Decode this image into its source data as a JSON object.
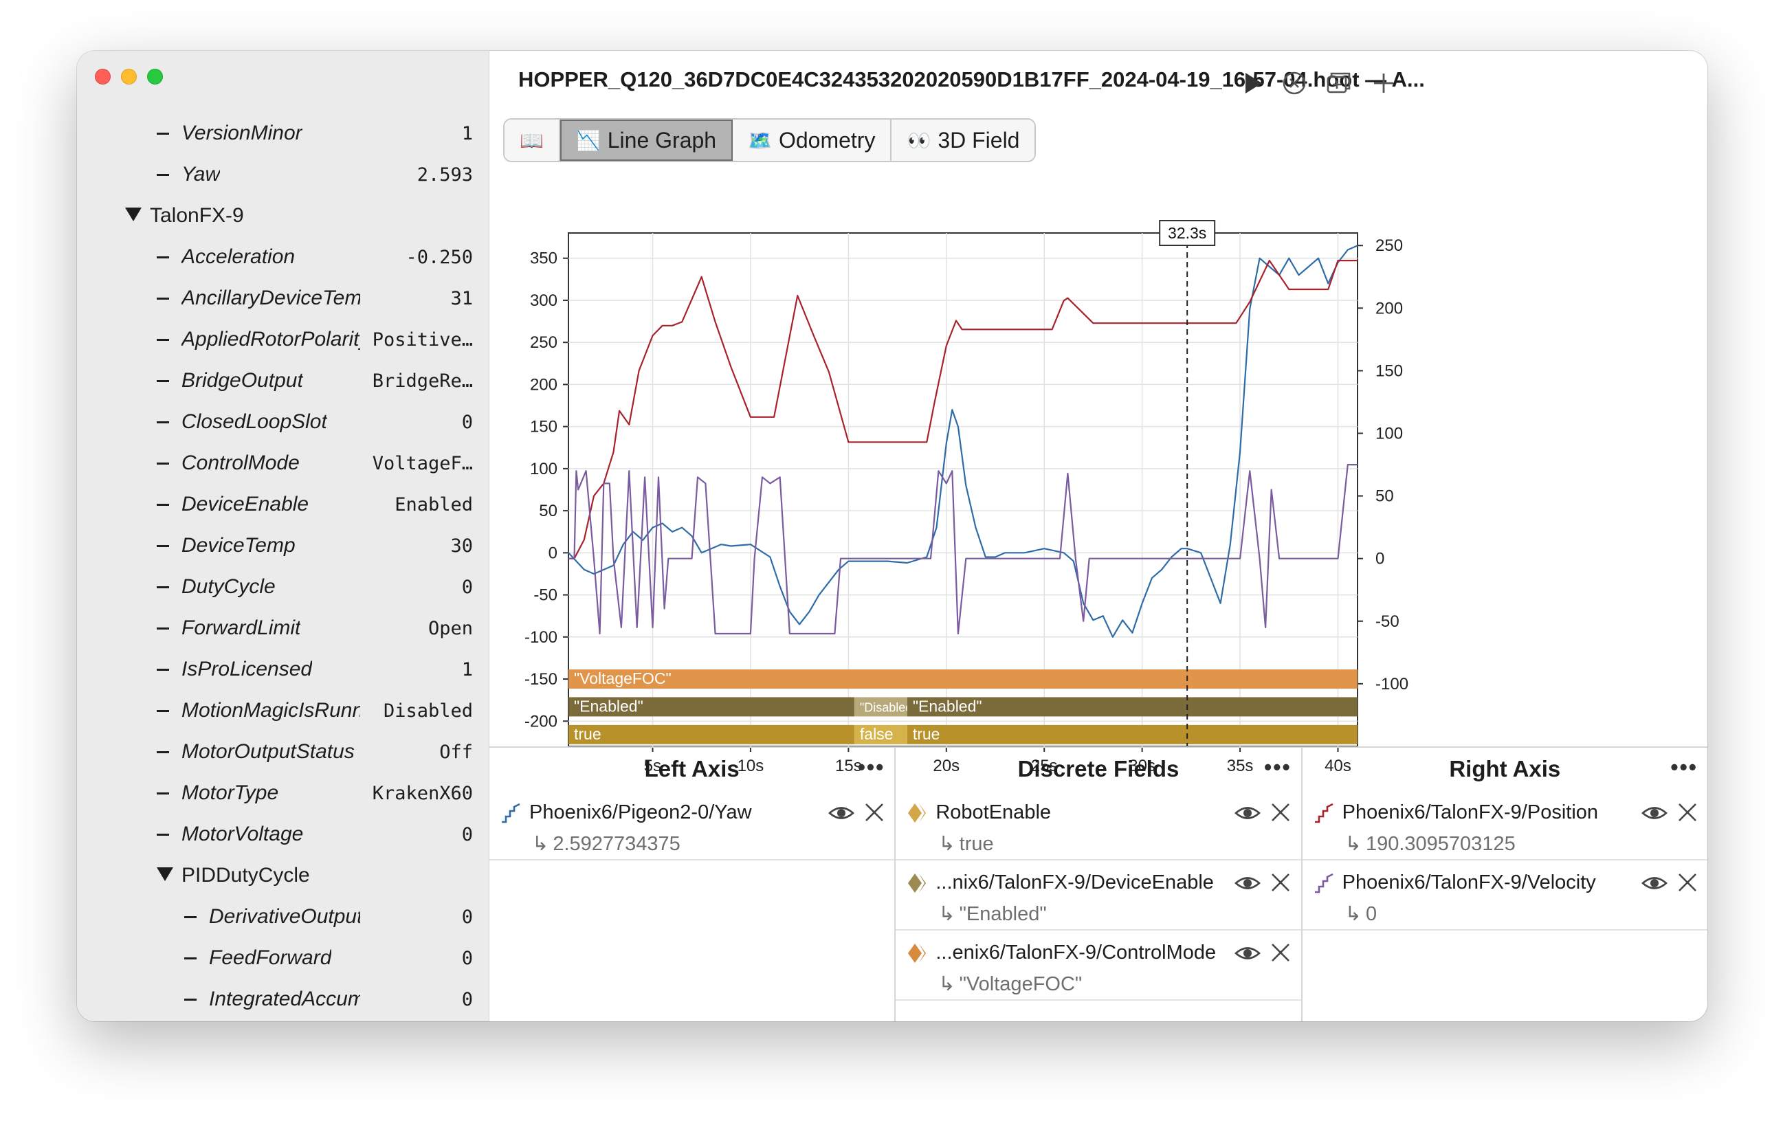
{
  "window": {
    "title": "HOPPER_Q120_36D7DC0E4C324353202020590D1B17FF_2024-04-19_16-57-04.hoot — A..."
  },
  "sidebar": {
    "rows": [
      {
        "label": "VersionMinor",
        "value": "1"
      },
      {
        "label": "Yaw",
        "value": "2.593"
      },
      {
        "label": "TalonFX-9",
        "value": ""
      },
      {
        "label": "Acceleration",
        "value": "-0.250"
      },
      {
        "label": "AncillaryDeviceTemp",
        "value": "31"
      },
      {
        "label": "AppliedRotorPolarity",
        "value": "Positive…"
      },
      {
        "label": "BridgeOutput",
        "value": "BridgeRe…"
      },
      {
        "label": "ClosedLoopSlot",
        "value": "0"
      },
      {
        "label": "ControlMode",
        "value": "VoltageF…"
      },
      {
        "label": "DeviceEnable",
        "value": "Enabled"
      },
      {
        "label": "DeviceTemp",
        "value": "30"
      },
      {
        "label": "DutyCycle",
        "value": "0"
      },
      {
        "label": "ForwardLimit",
        "value": "Open"
      },
      {
        "label": "IsProLicensed",
        "value": "1"
      },
      {
        "label": "MotionMagicIsRunning",
        "value": "Disabled"
      },
      {
        "label": "MotorOutputStatus",
        "value": "Off"
      },
      {
        "label": "MotorType",
        "value": "KrakenX60"
      },
      {
        "label": "MotorVoltage",
        "value": "0"
      },
      {
        "label": "PIDDutyCycle",
        "value": ""
      },
      {
        "label": "DerivativeOutput",
        "value": "0"
      },
      {
        "label": "FeedForward",
        "value": "0"
      },
      {
        "label": "IntegratedAccum",
        "value": "0"
      }
    ]
  },
  "tabs": [
    {
      "icon": "📖",
      "label": ""
    },
    {
      "icon": "📉",
      "label": "Line Graph"
    },
    {
      "icon": "🗺️",
      "label": "Odometry"
    },
    {
      "icon": "👀",
      "label": "3D Field"
    }
  ],
  "chart_data": {
    "type": "line",
    "cursor_label": "32.3s",
    "x_ticks": [
      "5s",
      "10s",
      "15s",
      "20s",
      "25s",
      "30s",
      "35s",
      "40s"
    ],
    "xlim": [
      0.7,
      41.0
    ],
    "left_axis": {
      "ticks": [
        "350",
        "300",
        "250",
        "200",
        "150",
        "100",
        "50",
        "0",
        "-50",
        "-100",
        "-150",
        "-200"
      ],
      "ylim": [
        -230,
        380
      ]
    },
    "right_axis": {
      "ticks": [
        "250",
        "200",
        "150",
        "100",
        "50",
        "0",
        "-50",
        "-100"
      ],
      "ylim": [
        -150,
        260
      ]
    },
    "series": [
      {
        "name": "Phoenix6/Pigeon2-0/Yaw",
        "axis": "left",
        "color": "#2f6ca7",
        "x": [
          0.7,
          1.5,
          2.0,
          3.0,
          3.5,
          4.0,
          4.5,
          5.0,
          5.5,
          6.0,
          6.5,
          7.0,
          7.5,
          8.0,
          8.5,
          9.0,
          10.0,
          11.0,
          11.5,
          12.0,
          12.5,
          13.0,
          13.5,
          14.0,
          14.5,
          15.0,
          16.0,
          17.0,
          18.0,
          19.0,
          19.5,
          20.0,
          20.3,
          20.6,
          21.0,
          21.5,
          22.0,
          22.5,
          23.0,
          24.0,
          25.0,
          26.0,
          26.5,
          27.0,
          27.5,
          28.0,
          28.5,
          29.0,
          29.5,
          30.0,
          30.5,
          31.0,
          31.5,
          32.0,
          32.3,
          33.0,
          33.5,
          34.0,
          34.5,
          35.0,
          35.5,
          36.0,
          36.5,
          37.0,
          37.5,
          38.0,
          38.5,
          39.0,
          39.5,
          40.0,
          40.5,
          41.0
        ],
        "y": [
          0,
          -20,
          -25,
          -15,
          10,
          25,
          15,
          30,
          35,
          25,
          30,
          20,
          0,
          5,
          10,
          8,
          10,
          -5,
          -40,
          -70,
          -85,
          -70,
          -50,
          -35,
          -20,
          -10,
          -10,
          -10,
          -12,
          -5,
          30,
          130,
          170,
          150,
          80,
          30,
          -5,
          -5,
          0,
          0,
          5,
          0,
          -10,
          -60,
          -80,
          -75,
          -100,
          -80,
          -95,
          -60,
          -30,
          -20,
          -5,
          5,
          5,
          0,
          -30,
          -60,
          10,
          120,
          290,
          350,
          340,
          330,
          350,
          330,
          340,
          350,
          320,
          345,
          360,
          365
        ]
      },
      {
        "name": "Phoenix6/TalonFX-9/Position",
        "axis": "right",
        "color": "#a7222c",
        "x": [
          0.7,
          1.0,
          1.5,
          2.0,
          2.5,
          3.0,
          3.3,
          3.8,
          4.3,
          5.0,
          5.5,
          6.0,
          6.5,
          7.5,
          8.2,
          9.0,
          10.0,
          11.0,
          11.2,
          12.4,
          13.2,
          14.0,
          15.0,
          16.5,
          18.0,
          19.0,
          19.4,
          20.0,
          20.5,
          20.8,
          21.5,
          22.0,
          24.5,
          25.4,
          26.0,
          26.2,
          27.5,
          30.0,
          33.0,
          34.0,
          34.8,
          35.5,
          36.5,
          37.5,
          38.0,
          39.5,
          40.0,
          41.0
        ],
        "y": [
          0,
          0,
          15,
          50,
          60,
          85,
          118,
          107,
          150,
          178,
          186,
          186,
          189,
          225,
          189,
          153,
          113,
          113,
          113,
          210,
          179,
          149,
          93,
          93,
          93,
          93,
          125,
          170,
          190,
          183,
          183,
          183,
          183,
          183,
          206,
          208,
          188,
          188,
          188,
          188,
          188,
          205,
          238,
          215,
          215,
          215,
          238,
          238
        ]
      },
      {
        "name": "Phoenix6/TalonFX-9/Velocity",
        "axis": "right",
        "color": "#7a5ba0",
        "x": [
          0.7,
          1.0,
          1.1,
          1.2,
          1.6,
          2.0,
          2.3,
          2.5,
          2.8,
          3.0,
          3.4,
          3.8,
          4.2,
          4.6,
          5.0,
          5.3,
          5.6,
          5.8,
          6.2,
          7.0,
          7.3,
          7.7,
          8.2,
          8.5,
          8.8,
          9.0,
          9.5,
          10.0,
          10.2,
          10.6,
          11.0,
          11.5,
          12.0,
          12.2,
          12.5,
          13.0,
          14.0,
          14.3,
          14.6,
          15.0,
          16.0,
          17.0,
          18.0,
          19.0,
          19.2,
          19.6,
          20.0,
          20.3,
          20.6,
          21.0,
          21.2,
          21.6,
          22.0,
          23.0,
          24.0,
          25.0,
          25.8,
          26.2,
          26.6,
          27.0,
          27.3,
          27.7,
          28.0,
          28.5,
          29.0,
          29.5,
          30.0,
          30.5,
          31.0,
          31.5,
          32.0,
          32.3,
          33.0,
          33.5,
          34.0,
          34.5,
          35.0,
          35.5,
          36.0,
          36.3,
          36.6,
          37.0,
          37.5,
          38.0,
          38.5,
          39.0,
          39.5,
          40.0,
          40.5,
          41.0
        ],
        "y": [
          0,
          0,
          70,
          55,
          70,
          0,
          -60,
          60,
          60,
          0,
          -55,
          70,
          -55,
          65,
          -55,
          65,
          -40,
          0,
          0,
          0,
          65,
          60,
          -60,
          -60,
          -60,
          -60,
          -60,
          -60,
          0,
          65,
          60,
          65,
          -60,
          -60,
          -60,
          -60,
          -60,
          -60,
          0,
          0,
          0,
          0,
          0,
          0,
          0,
          70,
          60,
          70,
          -60,
          0,
          0,
          0,
          0,
          0,
          0,
          0,
          0,
          68,
          0,
          -50,
          0,
          0,
          0,
          0,
          0,
          0,
          0,
          0,
          0,
          0,
          0,
          0,
          0,
          0,
          0,
          0,
          0,
          70,
          0,
          -55,
          55,
          0,
          0,
          0,
          0,
          0,
          0,
          0,
          75,
          75
        ]
      }
    ],
    "discrete": [
      {
        "name": "Phoenix6/TalonFX-9/ControlMode",
        "color": "#e0954a",
        "segments": [
          {
            "from": 0.7,
            "to": 41.0,
            "label": "\"VoltageFOC\""
          }
        ]
      },
      {
        "name": "Phoenix6/TalonFX-9/DeviceEnable",
        "color": "#7b6a3a",
        "segments": [
          {
            "from": 0.7,
            "to": 15.3,
            "label": "\"Enabled\""
          },
          {
            "from": 15.3,
            "to": 18.0,
            "label": "\"Disabled\"",
            "color": "#b7a97a"
          },
          {
            "from": 18.0,
            "to": 41.0,
            "label": "\"Enabled\""
          }
        ]
      },
      {
        "name": "RobotEnable",
        "color": "#b8912a",
        "segments": [
          {
            "from": 0.7,
            "to": 15.3,
            "label": "true"
          },
          {
            "from": 15.3,
            "to": 18.0,
            "label": "false",
            "color": "#d6b24a"
          },
          {
            "from": 18.0,
            "to": 41.0,
            "label": "true"
          }
        ]
      }
    ]
  },
  "panels": {
    "left": {
      "title": "Left Axis",
      "fields": [
        {
          "name": "Phoenix6/Pigeon2-0/Yaw",
          "value": "2.5927734375",
          "color": "#2f6ca7"
        }
      ]
    },
    "discrete": {
      "title": "Discrete Fields",
      "fields": [
        {
          "name": "RobotEnable",
          "value": "true",
          "color": "#d4a64a"
        },
        {
          "name": "...nix6/TalonFX-9/DeviceEnable",
          "value": "\"Enabled\"",
          "color": "#9c8a52"
        },
        {
          "name": "...enix6/TalonFX-9/ControlMode",
          "value": "\"VoltageFOC\"",
          "color": "#d88a3f"
        }
      ]
    },
    "right": {
      "title": "Right Axis",
      "fields": [
        {
          "name": "Phoenix6/TalonFX-9/Position",
          "value": "190.3095703125",
          "color": "#a7222c"
        },
        {
          "name": "Phoenix6/TalonFX-9/Velocity",
          "value": "0",
          "color": "#7a5ba0"
        }
      ]
    }
  }
}
